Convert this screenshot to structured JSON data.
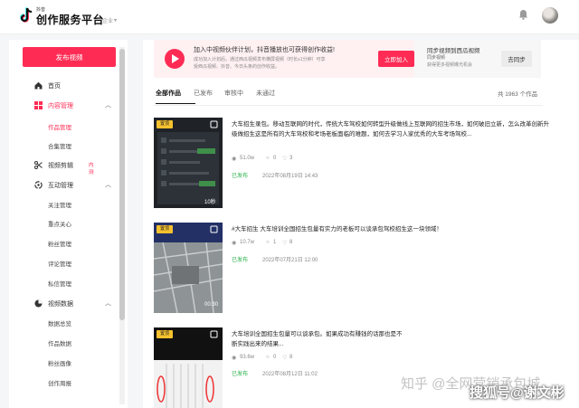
{
  "header": {
    "brand_small": "抖音",
    "brand": "创作服务平台",
    "version": "企业",
    "colors": {
      "accent": "#fe2c55"
    }
  },
  "sidebar": {
    "publish_label": "发布视频",
    "home": "首页",
    "content": "内容管理",
    "content_items": [
      "作品管理",
      "合集管理"
    ],
    "video_clip": "视频剪辑",
    "video_clip_badge": "内测",
    "interact": "互动管理",
    "interact_items": [
      "关注管理",
      "重点关心",
      "粉丝管理",
      "评论管理",
      "私信管理"
    ],
    "video_data": "视频数据",
    "video_data_items": [
      "数据总览",
      "作品数据",
      "粉丝画像",
      "创作周报"
    ]
  },
  "banner": {
    "title": "加入中视频伙伴计划，抖音播放也可获得创作收益!",
    "desc": "成功加入计划后，通过西瓜视频发布横屏视频（时长≥1分钟）可享受西瓜视频、抖音、今日头条的创作收益。",
    "button": "立即加入"
  },
  "sync": {
    "title": "同步视频到西瓜视频",
    "sub": "同步视频",
    "desc": "获得更多视频曝光机会",
    "button": "去同步"
  },
  "tabs": [
    "全部作品",
    "已发布",
    "审核中",
    "未通过"
  ],
  "count": "共 1963 个作品",
  "works": [
    {
      "tag": "置顶",
      "duration": "10秒",
      "desc": "大车招生录包。移动互联网的时代，传统大车驾校如何转型升级做线上互联网的招生市场，如何破旧立新，怎么改革创新升级做招生这是所有的大车驾校和考场老板面临的难题，如何去学习人家优秀的大车考场驾校...",
      "views": "51.0w",
      "comments": "0",
      "likes": "3",
      "status": "已发布",
      "date": "2022年08月19日 14:43"
    },
    {
      "tag": "置顶",
      "duration": "00:30",
      "desc": "#大车招生 大车培训全国招生包量有实力的老板可以谈承包驾校招生这一块领域！",
      "views": "10.7w",
      "comments": "1",
      "likes": "8",
      "status": "已发布",
      "date": "2022年07月21日 12:00"
    },
    {
      "tag": "置顶",
      "duration": "",
      "desc": "大车培训全国招生包量可以谈承包。如果成功有赚钱的话那也是不断实践出来的结果...",
      "views": "93.6w",
      "comments": "0",
      "likes": "8",
      "status": "已发布",
      "date": "2022年08月12日 11:02"
    }
  ],
  "watermark": {
    "zhihu": "知乎 @全网营销承包城",
    "sohu": "搜狐号@谢文彬"
  }
}
